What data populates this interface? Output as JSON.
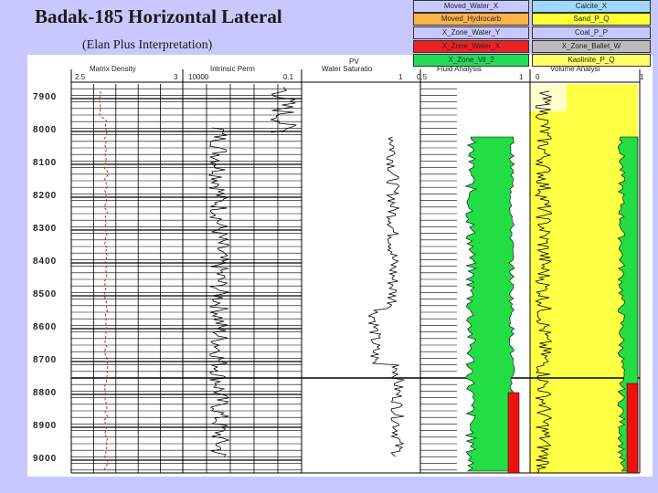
{
  "slide": {
    "title": "Badak-185 Horizontal Lateral",
    "subtitle": "(Elan Plus Interpretation)"
  },
  "legend": {
    "left": [
      {
        "label": "Moved_Water_X",
        "color": "#ffffff"
      },
      {
        "label": "Moved_Hydrocarb",
        "color": "#ffb347"
      },
      {
        "label": "X_Zone_Water_Y",
        "color": "#ffffff"
      },
      {
        "label": "X_Zone_Water_X",
        "color": "#ee2222"
      },
      {
        "label": "X_Zone_Vil_2",
        "color": "#22dd55"
      },
      {
        "label": "Fluid Analysis",
        "color": "#ffffff"
      }
    ],
    "right": [
      {
        "label": "Calcite_X",
        "color": "#9fd8ff"
      },
      {
        "label": "Sand_P_Q",
        "color": "#ffff33"
      },
      {
        "label": "Coal_P_P",
        "color": "#ffffff"
      },
      {
        "label": "X_Zone_Ballet_W",
        "color": "#bbbbbb"
      },
      {
        "label": "Kaolinite_P_Q",
        "color": "#ffff66"
      },
      {
        "label": "Volume Analysi",
        "color": "#ffffff"
      }
    ]
  },
  "tracks": {
    "track1_label": "Matrix Density",
    "track2_label": "Intrinsic Perm",
    "track3_label": "PV",
    "track4_label": "Water Saturatio",
    "track1_scale_left": "2.5",
    "track1_scale_right": "3",
    "track2_scale_left": "10000",
    "track2_scale_right": "0.1",
    "track4_scale_left": "1",
    "track4_scale_right": "0.5",
    "track5_scale_right": "1",
    "track6_scale_left": "0",
    "track6_scale_right": "1"
  },
  "depths": [
    "7900",
    "8000",
    "8100",
    "8200",
    "8300",
    "8400",
    "8500",
    "8600",
    "8700",
    "8800",
    "8900",
    "9000"
  ],
  "colors": {
    "background": "#c8c8ff",
    "red_curve": "#dd2222",
    "green_fill": "#22dd44",
    "red_fill": "#ee1111",
    "yellow_fill": "#ffff44"
  }
}
